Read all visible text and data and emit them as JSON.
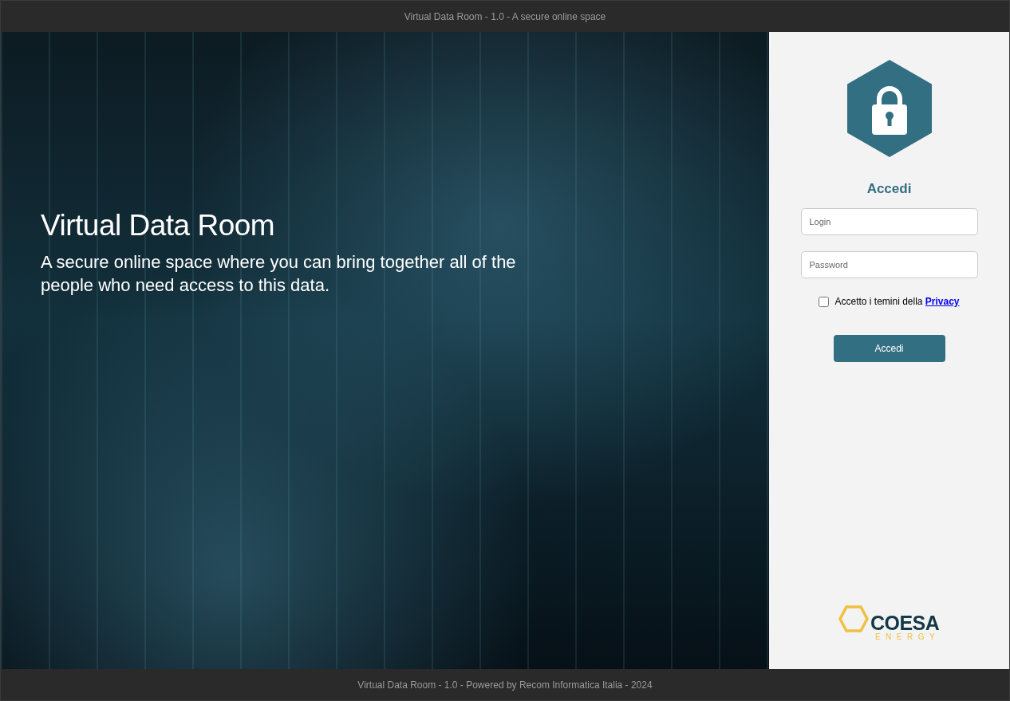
{
  "header": {
    "title": "Virtual Data Room - 1.0 - A secure online space"
  },
  "hero": {
    "title": "Virtual Data Room",
    "subtitle": "A secure online space where you can bring together all of the people who need access to this data."
  },
  "login": {
    "heading": "Accedi",
    "fields": [
      {
        "placeholder": "Login"
      },
      {
        "placeholder": "Password"
      }
    ],
    "privacy": {
      "checked": false,
      "label": "Accetto i temini della ",
      "link": "Privacy"
    },
    "button": "Accedi"
  },
  "logo": {
    "name": "COESA",
    "tagline": "ENERGY"
  },
  "footer": {
    "text": "Virtual Data Room - 1.0 - Powered by Recom Informatica Italia - 2024"
  }
}
